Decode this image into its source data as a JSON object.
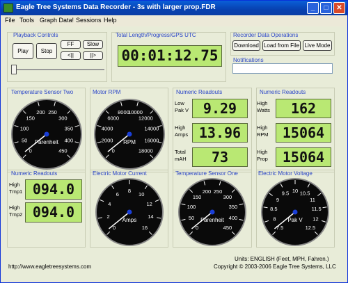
{
  "window": {
    "title": "Eagle Tree Systems Data Recorder - 3s with larger prop.FDR"
  },
  "menu": [
    "File",
    "Tools",
    "Graph Data!",
    "Sessions",
    "Help"
  ],
  "playback": {
    "title": "Playback Controls",
    "play": "Play",
    "stop": "Stop",
    "ff": "FF",
    "slow": "Slow",
    "prev": "<||",
    "next": "||>"
  },
  "length": {
    "title": "Total Length/Progress/GPS UTC",
    "value": "00:01:12.75"
  },
  "recorder": {
    "title": "Recorder Data Operations",
    "download": "Download",
    "load": "Load from File",
    "live": "Live Mode"
  },
  "notifications": {
    "title": "Notifications",
    "text": ""
  },
  "panels": {
    "temp_two": {
      "title": "Temperature Sensor Two",
      "ticks": [
        "0",
        "50",
        "100",
        "150",
        "200",
        "250",
        "300",
        "350",
        "400",
        "450"
      ],
      "unit": "Farenheit"
    },
    "motor_rpm": {
      "title": "Motor RPM",
      "ticks": [
        "0",
        "2000",
        "4000",
        "6000",
        "8000",
        "10000",
        "12000",
        "14000",
        "16000",
        "18000"
      ],
      "unit": "RPM"
    },
    "numeric1": {
      "title": "Numeric Readouts",
      "rows": [
        {
          "label": "Low Pak V",
          "value": "9.29"
        },
        {
          "label": "High Amps",
          "value": "13.96"
        },
        {
          "label": "Total mAH",
          "value": "73"
        }
      ]
    },
    "numeric2": {
      "title": "Numeric Readouts",
      "rows": [
        {
          "label": "High Watts",
          "value": "162"
        },
        {
          "label": "High RPM",
          "value": "15064"
        },
        {
          "label": "High Prop",
          "value": "15064"
        }
      ]
    },
    "numeric3": {
      "title": "Numeric Readouts",
      "rows": [
        {
          "label": "High Tmp1",
          "value": "094.0"
        },
        {
          "label": "High Tmp2",
          "value": "094.0"
        }
      ]
    },
    "motor_current": {
      "title": "Electric Motor Current",
      "ticks": [
        "0",
        "2",
        "4",
        "6",
        "8",
        "10",
        "12",
        "14",
        "16"
      ],
      "unit": "Amps"
    },
    "temp_one": {
      "title": "Temperature Sensor One",
      "ticks": [
        "0",
        "50",
        "100",
        "150",
        "200",
        "250",
        "300",
        "350",
        "400",
        "450"
      ],
      "unit": "Farenheit"
    },
    "motor_voltage": {
      "title": "Electric Motor Voltage",
      "ticks": [
        "7.5",
        "8",
        "8.5",
        "9",
        "9.5",
        "10",
        "10.5",
        "11",
        "11.5",
        "12",
        "12.5"
      ],
      "unit": "Pak V"
    }
  },
  "footer": {
    "url": "http://www.eagletreesystems.com",
    "units": "Units: ENGLISH (Feet, MPH, Fahren.)",
    "copyright": "Copyright © 2003-2006 Eagle Tree Systems, LLC"
  },
  "colors": {
    "lcd": "#b9e873",
    "panel_title": "#2b46c8",
    "titlebar": "#0a5fd8"
  }
}
